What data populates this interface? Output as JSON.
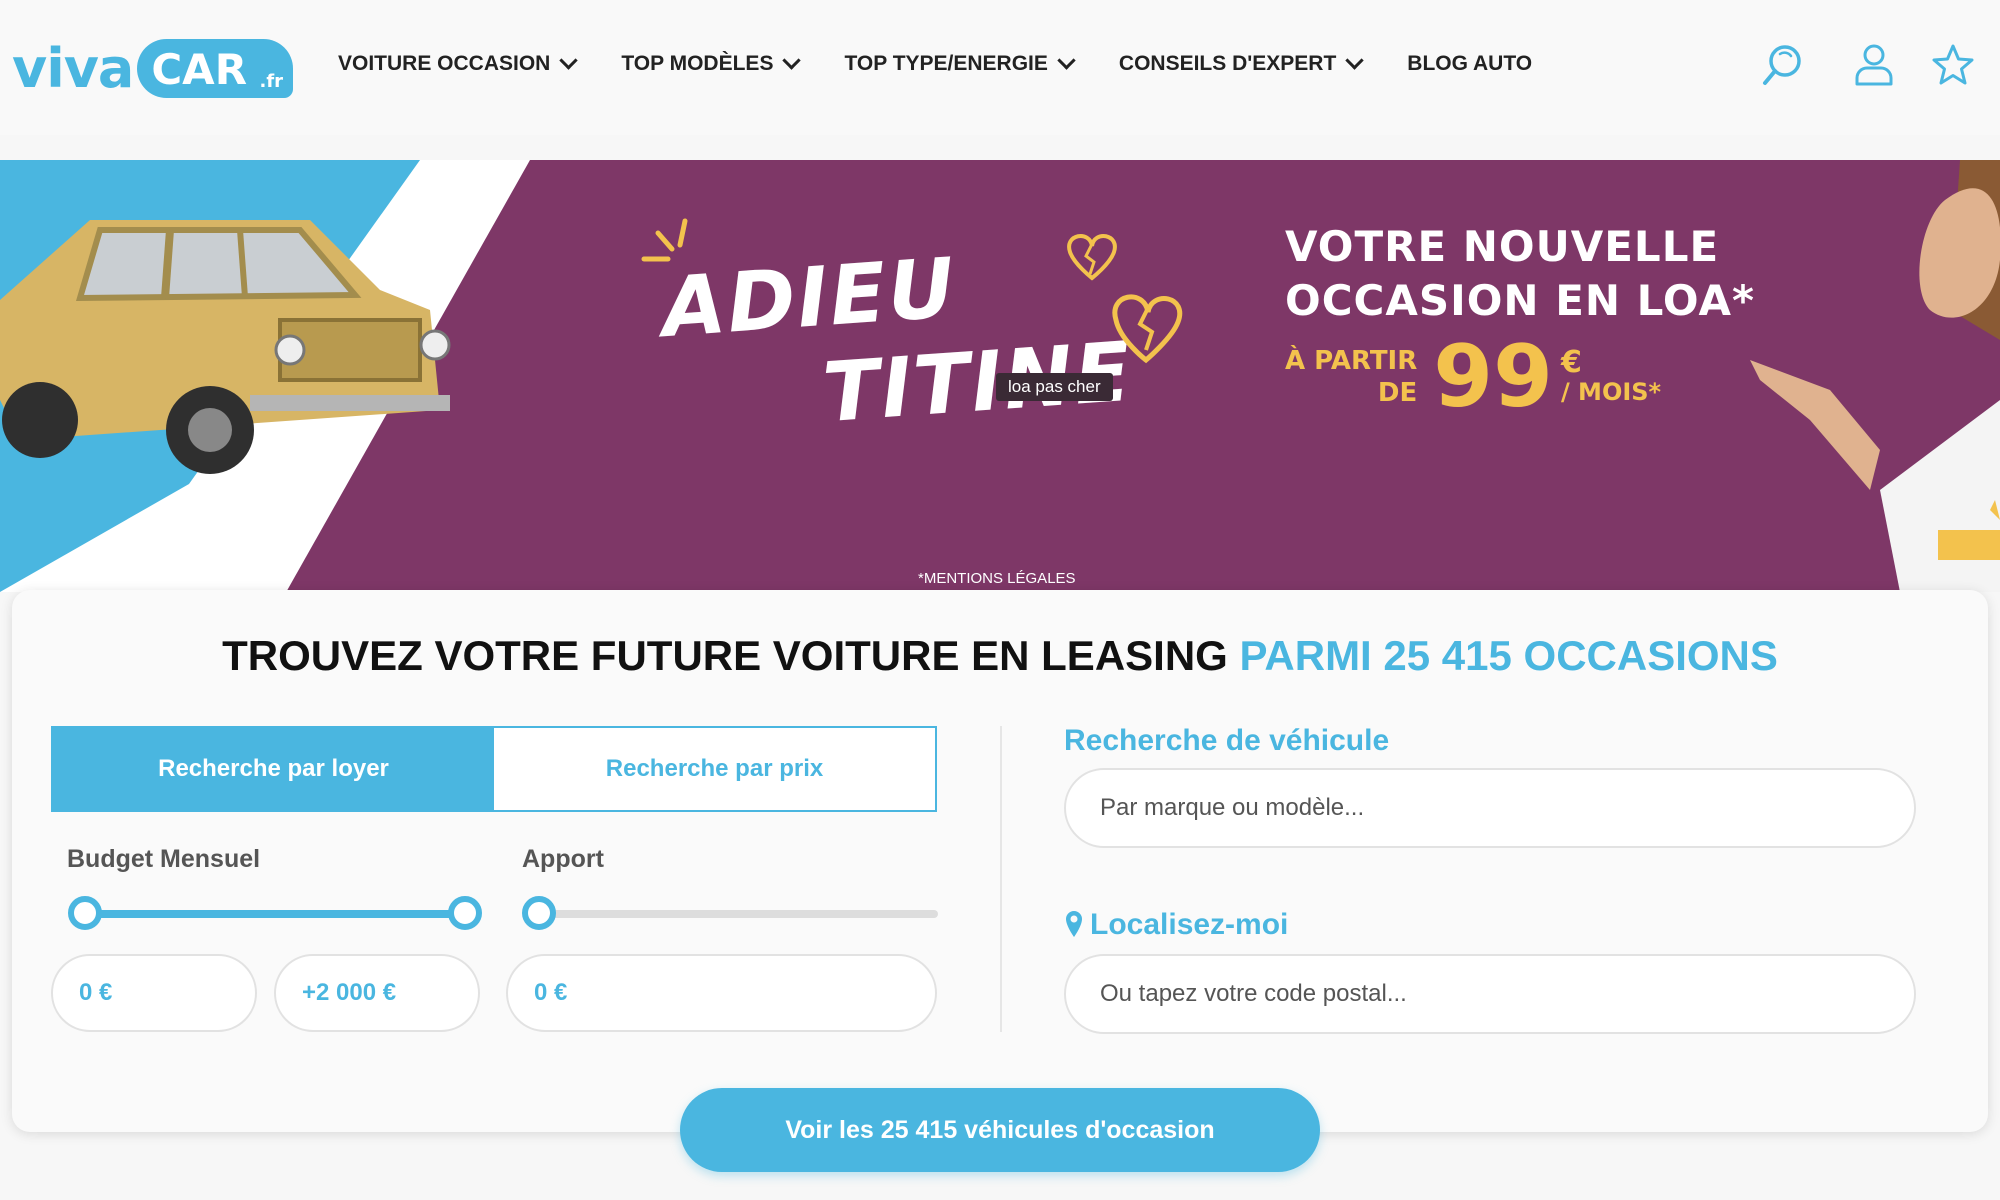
{
  "brand": {
    "viva": "viva",
    "car": "CAR",
    "fr": ".fr"
  },
  "nav": {
    "items": [
      {
        "label": "VOITURE OCCASION",
        "dropdown": true
      },
      {
        "label": "TOP MODÈLES",
        "dropdown": true
      },
      {
        "label": "TOP TYPE/ENERGIE",
        "dropdown": true
      },
      {
        "label": "CONSEILS D'EXPERT",
        "dropdown": true
      },
      {
        "label": "BLOG AUTO",
        "dropdown": false
      }
    ]
  },
  "header_icons": [
    "search-icon",
    "user-icon",
    "star-icon"
  ],
  "banner": {
    "headline_1": "ADIEU",
    "headline_2": "TITINE",
    "tooltip": "loa pas cher",
    "promo_line1": "VOTRE NOUVELLE",
    "promo_line2": "OCCASION EN LOA*",
    "promo_apartir_1": "À PARTIR",
    "promo_apartir_2": "DE",
    "promo_price": "99",
    "promo_currency": "€",
    "promo_period": "/ MOIS*",
    "mentions": "*MENTIONS LÉGALES"
  },
  "search": {
    "title_main": "TROUVEZ VOTRE FUTURE VOITURE EN LEASING ",
    "title_accent": "PARMI 25 415 OCCASIONS",
    "tab_loyer": "Recherche par loyer",
    "tab_prix": "Recherche par prix",
    "active_tab": "loyer",
    "budget_label": "Budget Mensuel",
    "apport_label": "Apport",
    "budget_min": "0 €",
    "budget_max": "+2 000 €",
    "apport_value": "0 €",
    "budget_range_fraction": [
      0,
      1
    ],
    "apport_fraction": 0,
    "vehicle_label": "Recherche de véhicule",
    "vehicle_placeholder": "Par marque ou modèle...",
    "locate_label": "Localisez-moi",
    "postal_placeholder": "Ou tapez votre code postal...",
    "cta": "Voir les 25 415 véhicules d'occasion"
  },
  "colors": {
    "accent": "#4ab6e0",
    "banner": "#7e3767",
    "gold": "#f3c24d"
  }
}
